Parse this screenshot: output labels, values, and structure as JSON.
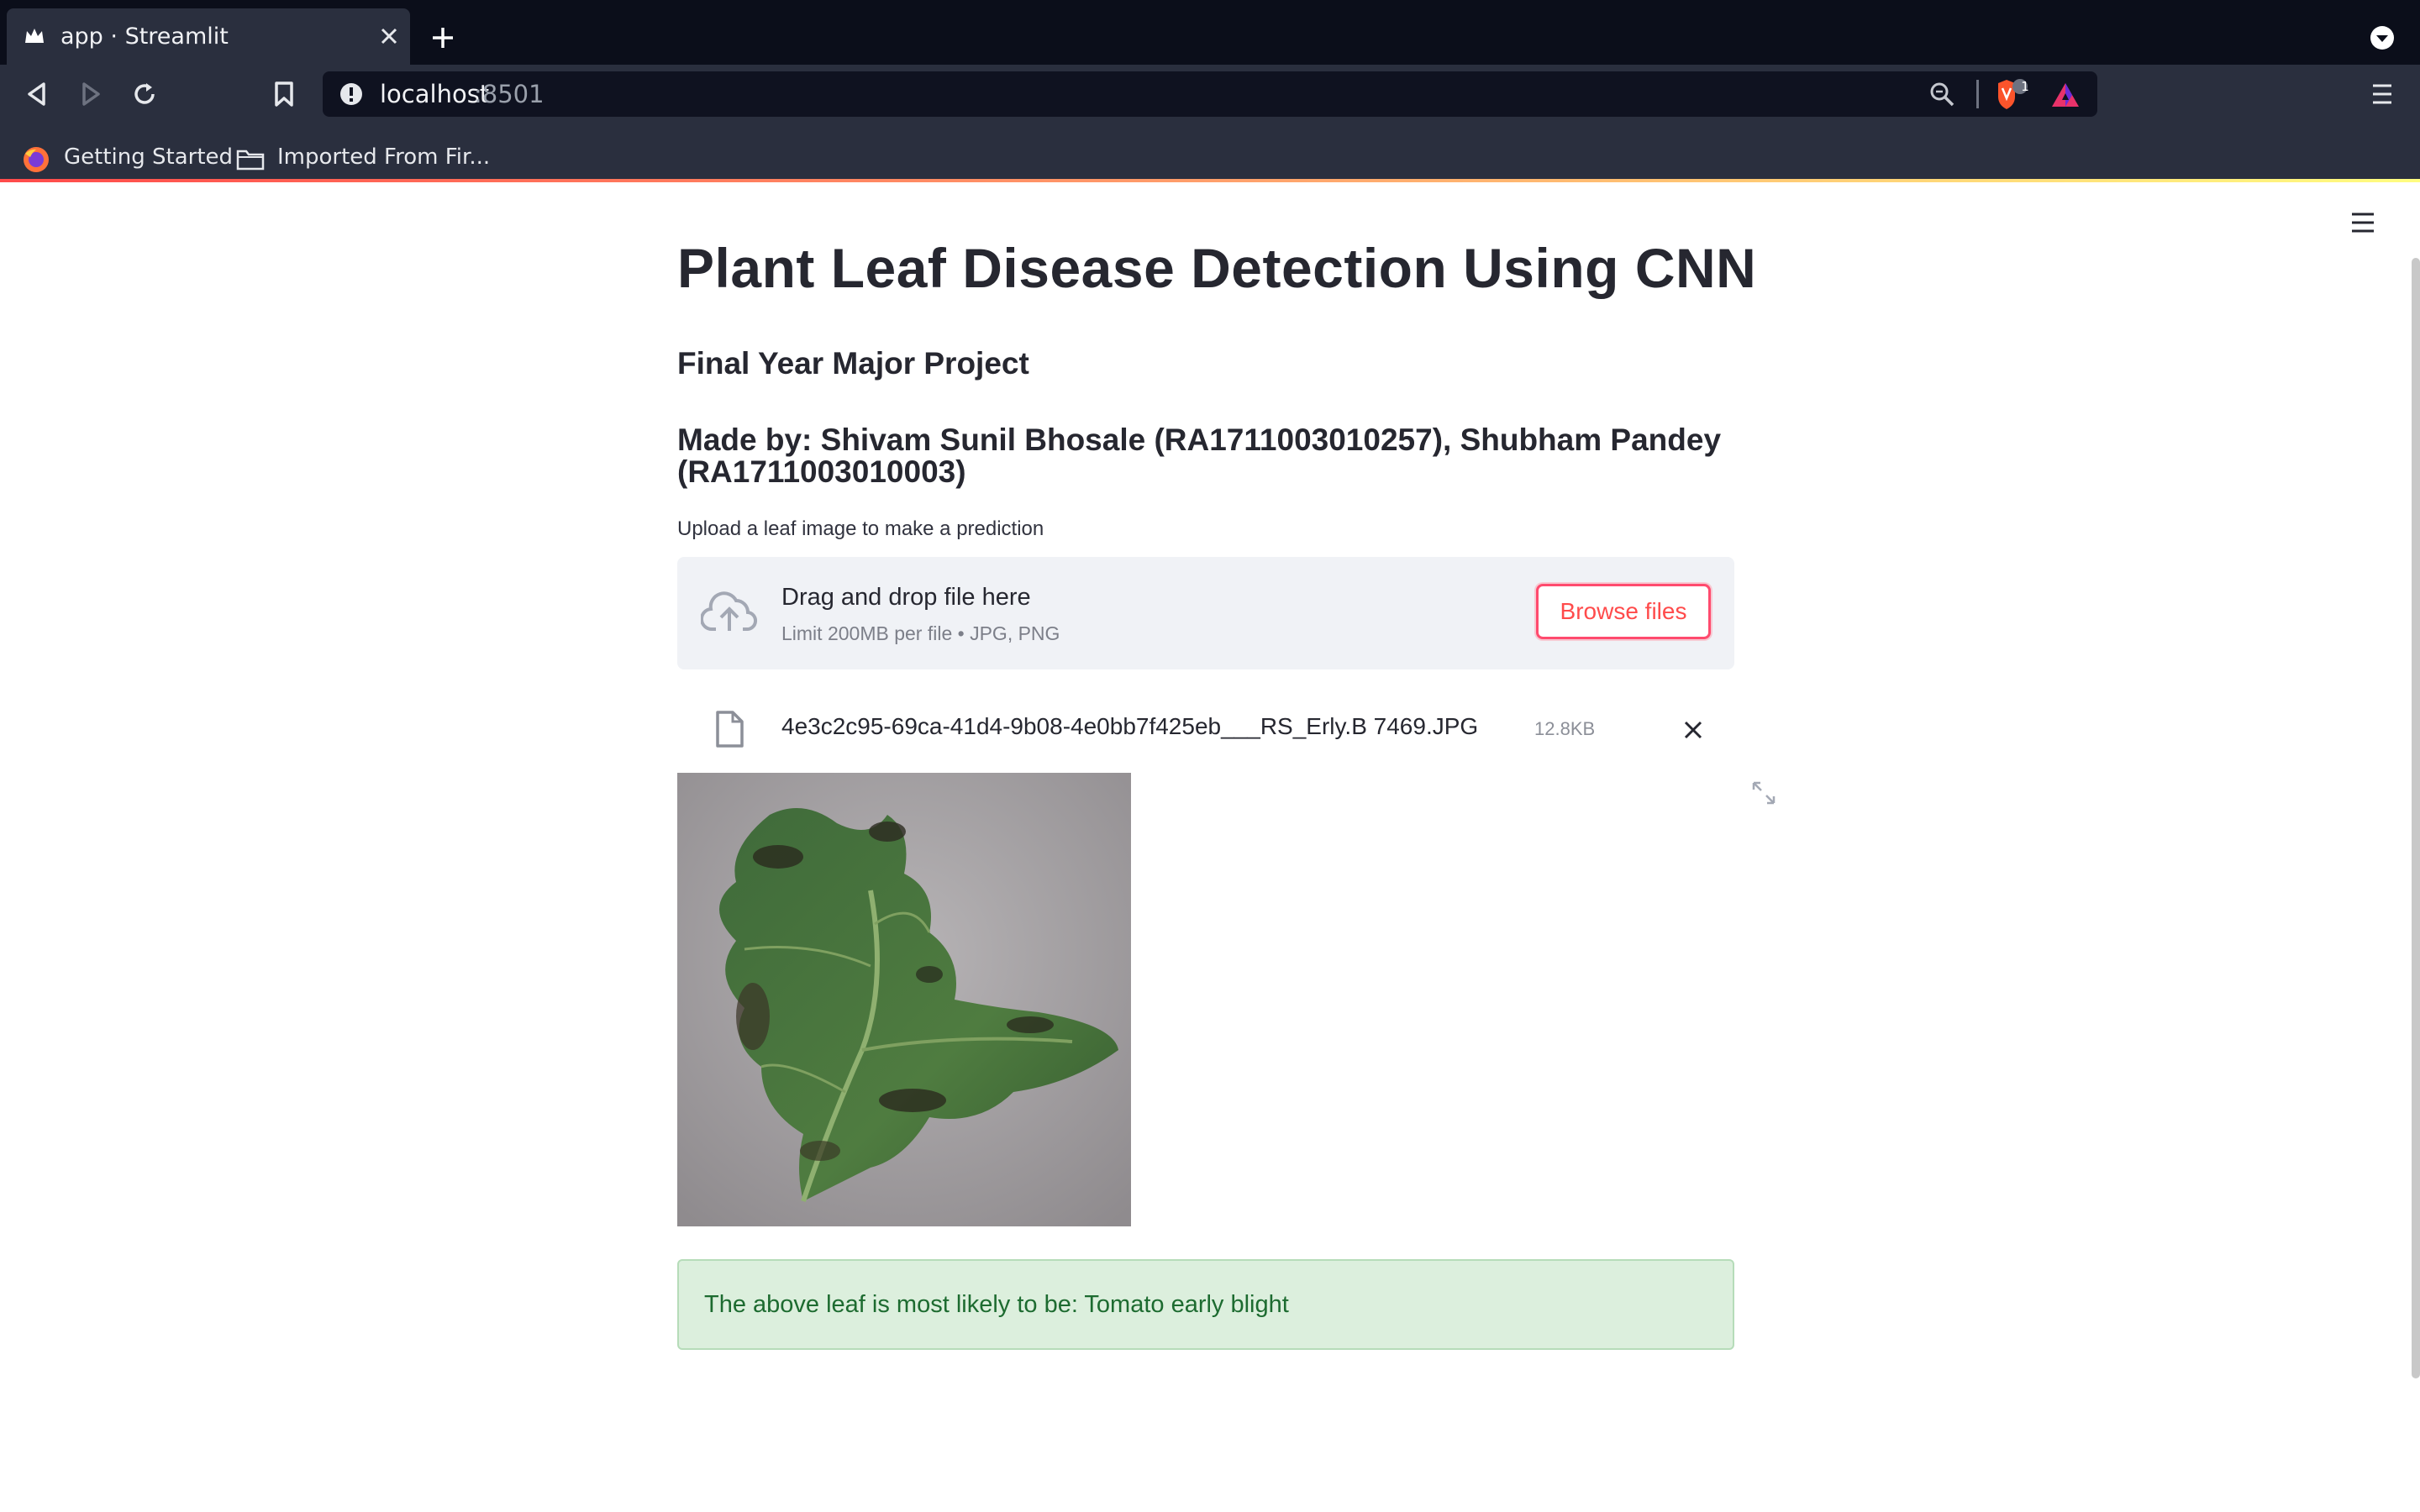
{
  "browser": {
    "tab_title": "app · Streamlit",
    "url_host": "localhost",
    "url_port": ":8501",
    "shield_count": "1",
    "bookmarks": [
      "Getting Started",
      "Imported From Fir..."
    ]
  },
  "app": {
    "title": "Plant Leaf Disease Detection Using CNN",
    "subtitle": "Final Year Major Project",
    "authors": "Made by: Shivam Sunil Bhosale (RA1711003010257), Shubham Pandey (RA1711003010003)",
    "upload_label": "Upload a leaf image to make a prediction",
    "uploader": {
      "drop_text": "Drag and drop file here",
      "limit_text": "Limit 200MB per file • JPG, PNG",
      "browse_label": "Browse files"
    },
    "uploaded_file": {
      "name": "4e3c2c95-69ca-41d4-9b08-4e0bb7f425eb___RS_Erly.B 7469.JPG",
      "size": "12.8KB"
    },
    "result_text": "The above leaf is most likely to be: Tomato early blight"
  },
  "colors": {
    "primary": "#ff4b4b",
    "success_bg": "#dcefdd",
    "success_text": "#1d6b30",
    "chrome_dark": "#0b0e1a",
    "chrome": "#2a2f3e"
  },
  "icons": [
    "streamlit-crown-icon",
    "tab-close-icon",
    "new-tab-icon",
    "tab-list-icon",
    "back-icon",
    "forward-icon",
    "reload-icon",
    "bookmark-icon",
    "site-info-icon",
    "zoom-icon",
    "brave-shield-icon",
    "brave-rewards-icon",
    "menu-icon",
    "firefox-icon",
    "folder-icon",
    "hamburger-menu-icon",
    "cloud-upload-icon",
    "file-icon",
    "remove-file-icon",
    "fullscreen-icon"
  ]
}
